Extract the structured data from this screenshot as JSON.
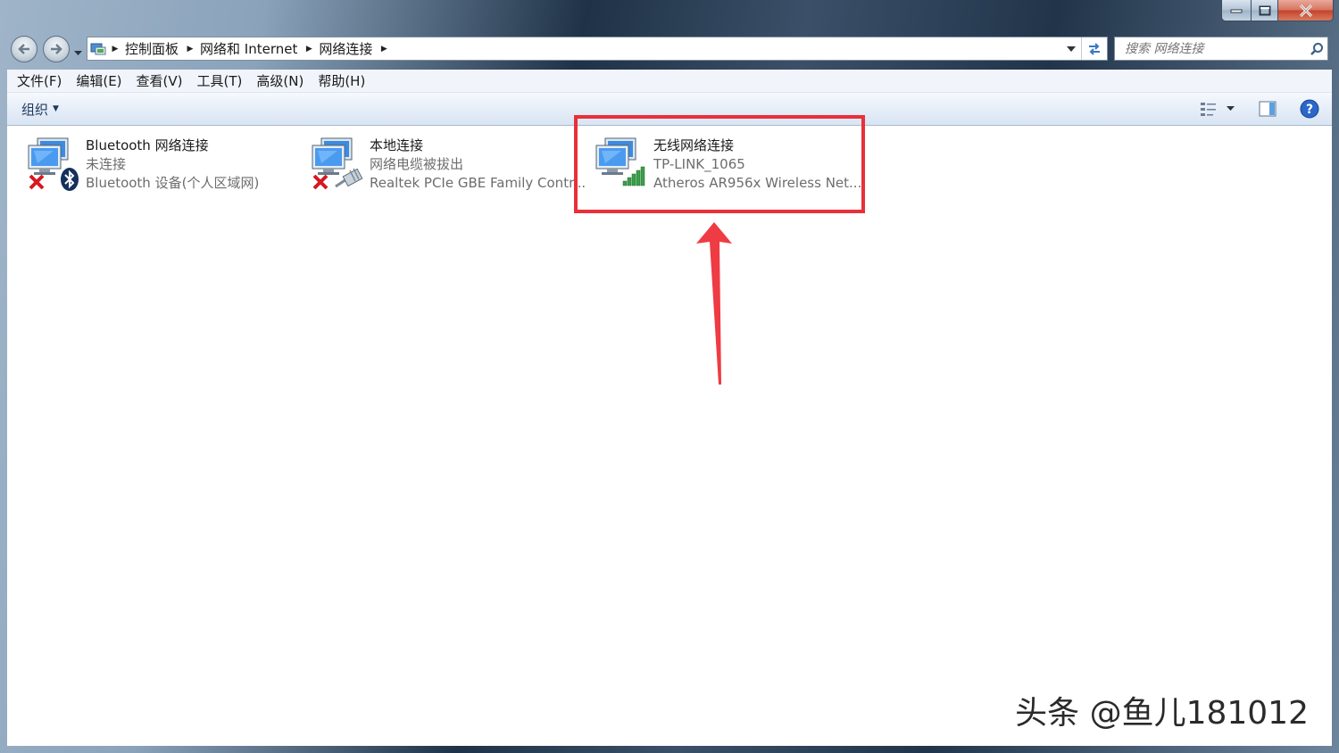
{
  "nav": {
    "breadcrumbs": [
      "控制面板",
      "网络和 Internet",
      "网络连接"
    ]
  },
  "search": {
    "placeholder": "搜索 网络连接"
  },
  "menu": [
    "文件(F)",
    "编辑(E)",
    "查看(V)",
    "工具(T)",
    "高级(N)",
    "帮助(H)"
  ],
  "toolbar": {
    "organize_label": "组织"
  },
  "connections": [
    {
      "name": "Bluetooth 网络连接",
      "status": "未连接",
      "device": "Bluetooth 设备(个人区域网)",
      "state": "disconnected",
      "badge": "bluetooth"
    },
    {
      "name": "本地连接",
      "status": "网络电缆被拔出",
      "device": "Realtek PCIe GBE Family Contr...",
      "state": "disconnected",
      "badge": "ethernet-cable"
    },
    {
      "name": "无线网络连接",
      "status": "TP-LINK_1065",
      "device": "Atheros AR956x Wireless Net...",
      "state": "connected",
      "badge": "signal-bars"
    }
  ],
  "annotation": {
    "highlight_color": "#e8303a",
    "highlighted_item": "无线网络连接"
  },
  "watermark": "头条 @鱼儿181012"
}
